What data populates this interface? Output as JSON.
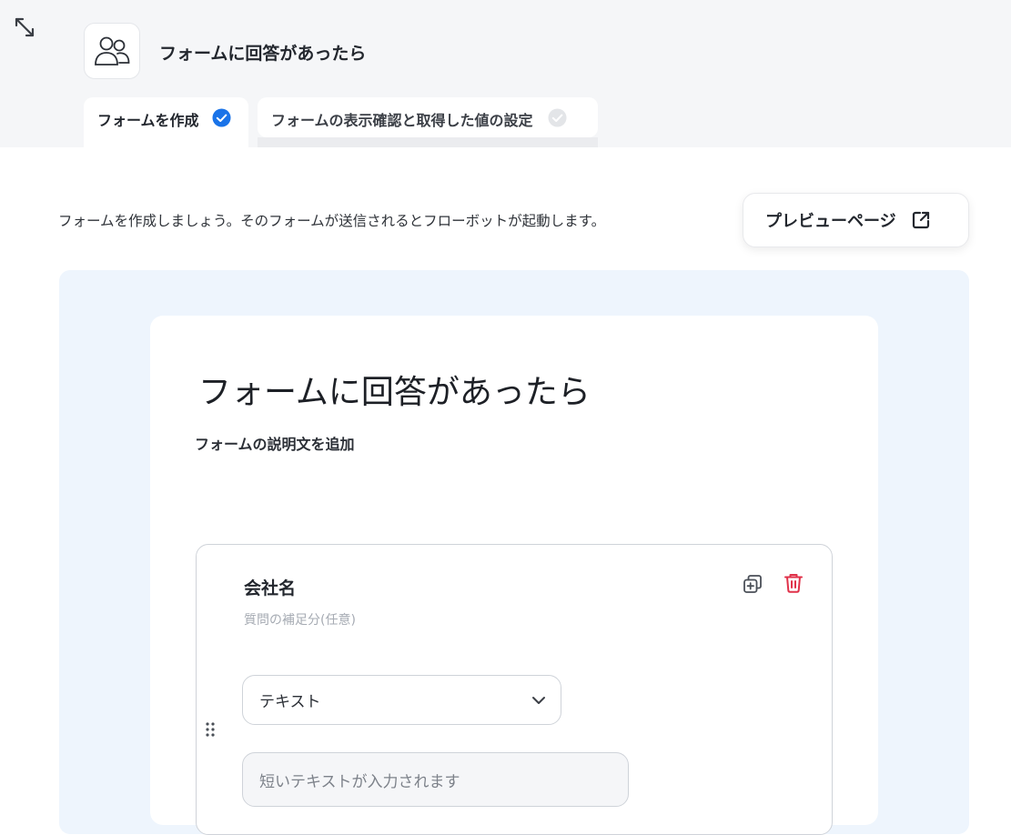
{
  "header": {
    "title": "フォームに回答があったら"
  },
  "tabs": [
    {
      "label": "フォームを作成",
      "status": "completed"
    },
    {
      "label": "フォームの表示確認と取得した値の設定",
      "status": "pending"
    }
  ],
  "intro": {
    "text": "フォームを作成しましょう。そのフォームが送信されるとフローボットが起動します。"
  },
  "preview_button": {
    "label": "プレビューページ"
  },
  "form": {
    "title": "フォームに回答があったら",
    "description_placeholder": "フォームの説明文を追加",
    "questions": [
      {
        "label": "会社名",
        "help_placeholder": "質問の補足分(任意)",
        "type_selected": "テキスト",
        "answer_placeholder": "短いテキストが入力されます"
      }
    ]
  },
  "icons": {
    "expand": "expand-arrows-icon",
    "app": "users-icon",
    "check_done": "check-circle-icon",
    "check_pending": "check-circle-icon",
    "external": "external-link-icon",
    "duplicate": "duplicate-icon",
    "delete": "trash-icon",
    "drag": "drag-handle-icon",
    "chevron": "chevron-down-icon"
  },
  "colors": {
    "accent": "#1a73e8",
    "danger": "#e0324a",
    "canvas_bg": "#eef5fd",
    "header_bg": "#f5f6f8"
  }
}
